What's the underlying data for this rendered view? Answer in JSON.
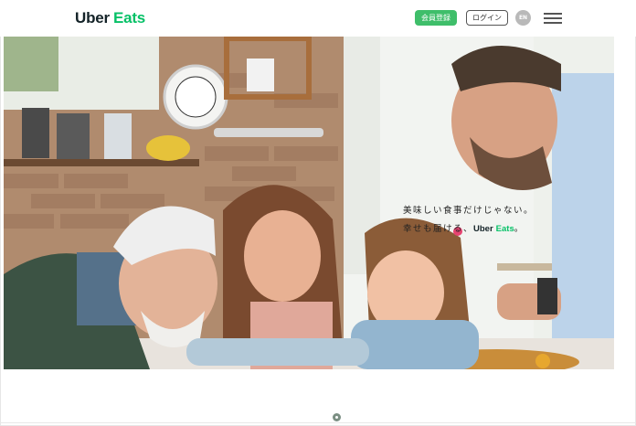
{
  "header": {
    "logo_uber": "Uber",
    "logo_eats": "Eats",
    "register_label": "会員登録",
    "login_label": "ログイン",
    "lang_label": "EN",
    "menu_icon": "hamburger-menu-icon"
  },
  "hero": {
    "tagline_line1": "美味しい食事だけじゃない。",
    "tagline_line2_prefix": "幸せも届ける、",
    "tagline_brand_uber": "Uber",
    "tagline_brand_eats": "Eats",
    "tagline_line2_suffix": "。"
  },
  "colors": {
    "brand_green": "#06c167",
    "register_button": "#3fbe6a",
    "logo_dark": "#142328"
  }
}
